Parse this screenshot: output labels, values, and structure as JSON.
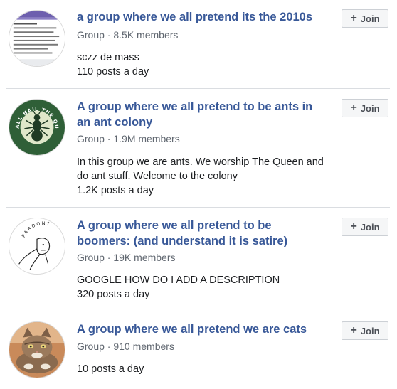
{
  "groups": [
    {
      "name": "a group where we all pretend its the 2010s",
      "meta": "Group · 8.5K members",
      "description": "sczz de mass",
      "activity": "110 posts a day",
      "join_label": "Join"
    },
    {
      "name": "A group where we all pretend to be ants in an ant colony",
      "meta": "Group · 1.9M members",
      "description": "In this group we are ants. We worship The Queen and do ant stuff. Welcome to the colony",
      "activity": "1.2K posts a day",
      "join_label": "Join",
      "avatar_text": "ALL HAIL THE QUEEN"
    },
    {
      "name": "A group where we all pretend to be boomers: (and understand it is satire)",
      "meta": "Group · 19K members",
      "description": "GOOGLE HOW DO I ADD A DESCRIPTION",
      "activity": "320 posts a day",
      "join_label": "Join",
      "avatar_text": "PARDON?"
    },
    {
      "name": "A group where we all pretend we are cats",
      "meta": "Group · 910 members",
      "description": "",
      "activity": "10 posts a day",
      "join_label": "Join"
    }
  ],
  "colors": {
    "link": "#385898",
    "meta": "#606770",
    "button_bg": "#f5f6f7",
    "button_border": "#ccd0d5",
    "divider": "#dadde1"
  }
}
